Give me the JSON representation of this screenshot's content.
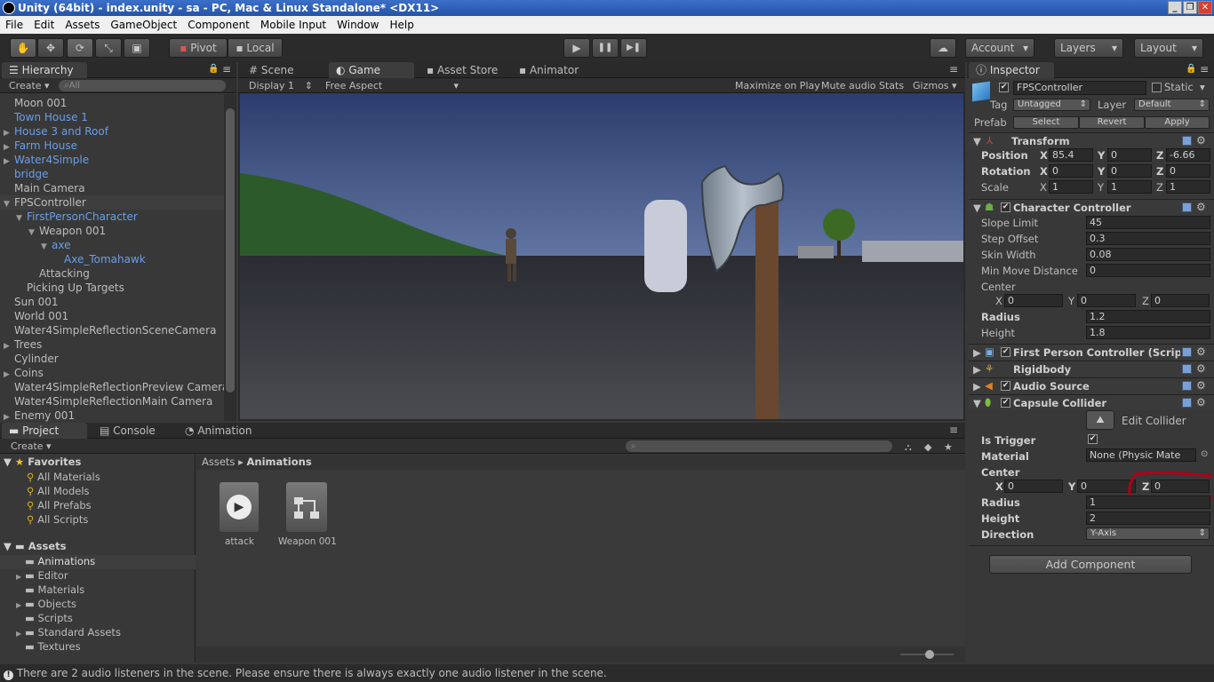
{
  "window": {
    "title": "Unity (64bit) - index.unity - sa - PC, Mac & Linux Standalone* <DX11>",
    "min": "_",
    "max": "❐",
    "close": "✕"
  },
  "menu": [
    "File",
    "Edit",
    "Assets",
    "GameObject",
    "Component",
    "Mobile Input",
    "Window",
    "Help"
  ],
  "toolbar": {
    "pivot": "Pivot",
    "local": "Local",
    "account": "Account",
    "layers": "Layers",
    "layout": "Layout"
  },
  "hierarchy": {
    "tab": "Hierarchy",
    "create": "Create",
    "search_placeholder": "All",
    "items": [
      {
        "label": "Moon 001",
        "indent": 0,
        "blue": false,
        "arrow": ""
      },
      {
        "label": "Town House 1",
        "indent": 0,
        "blue": true,
        "arrow": ""
      },
      {
        "label": "House 3 and Roof",
        "indent": 0,
        "blue": true,
        "arrow": "▶"
      },
      {
        "label": "Farm House",
        "indent": 0,
        "blue": true,
        "arrow": "▶"
      },
      {
        "label": "Water4Simple",
        "indent": 0,
        "blue": true,
        "arrow": "▶"
      },
      {
        "label": "bridge",
        "indent": 0,
        "blue": true,
        "arrow": ""
      },
      {
        "label": "Main Camera",
        "indent": 0,
        "blue": false,
        "arrow": ""
      },
      {
        "label": "FPSController",
        "indent": 0,
        "blue": false,
        "arrow": "▼",
        "selected": true
      },
      {
        "label": "FirstPersonCharacter",
        "indent": 1,
        "blue": true,
        "arrow": "▼"
      },
      {
        "label": "Weapon 001",
        "indent": 2,
        "blue": false,
        "arrow": "▼"
      },
      {
        "label": "axe",
        "indent": 3,
        "blue": true,
        "arrow": "▼"
      },
      {
        "label": "Axe_Tomahawk",
        "indent": 4,
        "blue": true,
        "arrow": ""
      },
      {
        "label": "Attacking",
        "indent": 2,
        "blue": false,
        "arrow": ""
      },
      {
        "label": "Picking Up Targets",
        "indent": 1,
        "blue": false,
        "arrow": ""
      },
      {
        "label": "Sun 001",
        "indent": 0,
        "blue": false,
        "arrow": ""
      },
      {
        "label": "World 001",
        "indent": 0,
        "blue": false,
        "arrow": ""
      },
      {
        "label": "Water4SimpleReflectionSceneCamera",
        "indent": 0,
        "blue": false,
        "arrow": ""
      },
      {
        "label": "Trees",
        "indent": 0,
        "blue": false,
        "arrow": "▶"
      },
      {
        "label": "Cylinder",
        "indent": 0,
        "blue": false,
        "arrow": ""
      },
      {
        "label": "Coins",
        "indent": 0,
        "blue": false,
        "arrow": "▶"
      },
      {
        "label": "Water4SimpleReflectionPreview Camera",
        "indent": 0,
        "blue": false,
        "arrow": ""
      },
      {
        "label": "Water4SimpleReflectionMain Camera",
        "indent": 0,
        "blue": false,
        "arrow": ""
      },
      {
        "label": "Enemy 001",
        "indent": 0,
        "blue": false,
        "arrow": "▶"
      }
    ]
  },
  "center_tabs": {
    "scene": "Scene",
    "game": "Game",
    "asset_store": "Asset Store",
    "animator": "Animator"
  },
  "game_bar": {
    "display": "Display 1",
    "aspect": "Free Aspect",
    "maximize": "Maximize on Play",
    "mute": "Mute audio",
    "stats": "Stats",
    "gizmos": "Gizmos"
  },
  "project": {
    "tabs": {
      "project": "Project",
      "console": "Console",
      "animation": "Animation"
    },
    "create": "Create",
    "favorites": {
      "label": "Favorites",
      "items": [
        "All Materials",
        "All Models",
        "All Prefabs",
        "All Scripts"
      ]
    },
    "assets": {
      "label": "Assets",
      "items": [
        {
          "label": "Animations",
          "arrow": ""
        },
        {
          "label": "Editor",
          "arrow": "▶"
        },
        {
          "label": "Materials",
          "arrow": ""
        },
        {
          "label": "Objects",
          "arrow": "▶"
        },
        {
          "label": "Scripts",
          "arrow": ""
        },
        {
          "label": "Standard Assets",
          "arrow": "▶"
        },
        {
          "label": "Textures",
          "arrow": ""
        }
      ]
    },
    "breadcrumb": {
      "root": "Assets",
      "sep": "▸",
      "current": "Animations"
    },
    "files": [
      {
        "label": "attack",
        "kind": "clip"
      },
      {
        "label": "Weapon 001",
        "kind": "controller"
      }
    ]
  },
  "inspector": {
    "tab": "Inspector",
    "name": "FPSController",
    "static": "Static",
    "tag_label": "Tag",
    "tag": "Untagged",
    "layer_label": "Layer",
    "layer": "Default",
    "prefab_label": "Prefab",
    "select": "Select",
    "revert": "Revert",
    "apply": "Apply",
    "transform": {
      "title": "Transform",
      "position": {
        "label": "Position",
        "x": "85.4",
        "y": "0",
        "z": "-6.66"
      },
      "rotation": {
        "label": "Rotation",
        "x": "0",
        "y": "0",
        "z": "0"
      },
      "scale": {
        "label": "Scale",
        "x": "1",
        "y": "1",
        "z": "1"
      }
    },
    "character_controller": {
      "title": "Character Controller",
      "slope_label": "Slope Limit",
      "slope": "45",
      "step_label": "Step Offset",
      "step": "0.3",
      "skin_label": "Skin Width",
      "skin": "0.08",
      "min_move_label": "Min Move Distance",
      "min_move": "0",
      "center_label": "Center",
      "cx": "0",
      "cy": "0",
      "cz": "0",
      "radius_label": "Radius",
      "radius": "1.2",
      "height_label": "Height",
      "height": "1.8"
    },
    "fpc": {
      "title": "First Person Controller (Scrip"
    },
    "rigidbody": {
      "title": "Rigidbody"
    },
    "audio": {
      "title": "Audio Source"
    },
    "capsule": {
      "title": "Capsule Collider",
      "edit": "Edit Collider",
      "trigger_label": "Is Trigger",
      "material_label": "Material",
      "material": "None (Physic Mate",
      "center_label": "Center",
      "cx": "0",
      "cy": "0",
      "cz": "0",
      "radius_label": "Radius",
      "radius": "1",
      "height_label": "Height",
      "height": "2",
      "direction_label": "Direction",
      "direction": "Y-Axis"
    },
    "add_component": "Add Component"
  },
  "axes": {
    "x": "X",
    "y": "Y",
    "z": "Z"
  },
  "status": "There are 2 audio listeners in the scene. Please ensure there is always exactly one audio listener in the scene.",
  "icons": {
    "hand": "hand-tool-icon",
    "move": "move-tool-icon",
    "rotate": "rotate-tool-icon",
    "scale": "scale-tool-icon",
    "rect": "rect-tool-icon",
    "play": "▶",
    "pause": "❚❚",
    "step": "▶❚",
    "lock": "lock-icon",
    "menu": "≡",
    "checkmark": "✔",
    "warning": "!"
  },
  "colors": {
    "annotation": "#b0001a",
    "link": "#6a9ee8"
  }
}
